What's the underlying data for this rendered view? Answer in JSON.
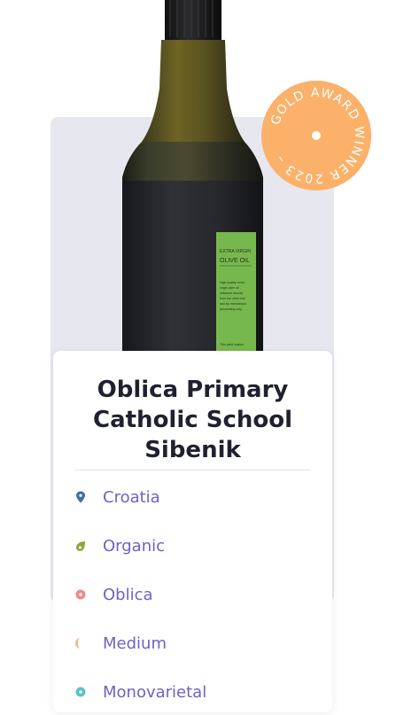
{
  "badge": {
    "text": "GOLD AWARD WINNER 2023 – ",
    "color": "#fbb16a"
  },
  "bottle_label": {
    "heading1": "EXTRA VIRGIN",
    "heading2": "OLIVE OIL",
    "body": [
      "High quality extra",
      "virgin olive oil",
      "obtained directly",
      "from the olive fruit",
      "and by mechanical",
      "processing only.",
      "",
      "This yield marker"
    ]
  },
  "product": {
    "title_lines": [
      "Oblica Primary",
      "Catholic School",
      "Sibenik"
    ],
    "attributes": [
      {
        "label": "Croatia",
        "icon": "location-pin-icon",
        "color": "#3f6fa8"
      },
      {
        "label": "Organic",
        "icon": "leaf-icon",
        "color": "#8aa63a"
      },
      {
        "label": "Oblica",
        "icon": "olive-variety-icon",
        "color": "#ef8a8a"
      },
      {
        "label": "Medium",
        "icon": "intensity-icon",
        "color": "#f6b77a"
      },
      {
        "label": "Monovarietal",
        "icon": "blend-icon",
        "color": "#5cc3c7"
      }
    ]
  },
  "colors": {
    "accent_text": "#6a63c9",
    "title": "#1f2130",
    "panel_bg": "#e7e7f0"
  }
}
